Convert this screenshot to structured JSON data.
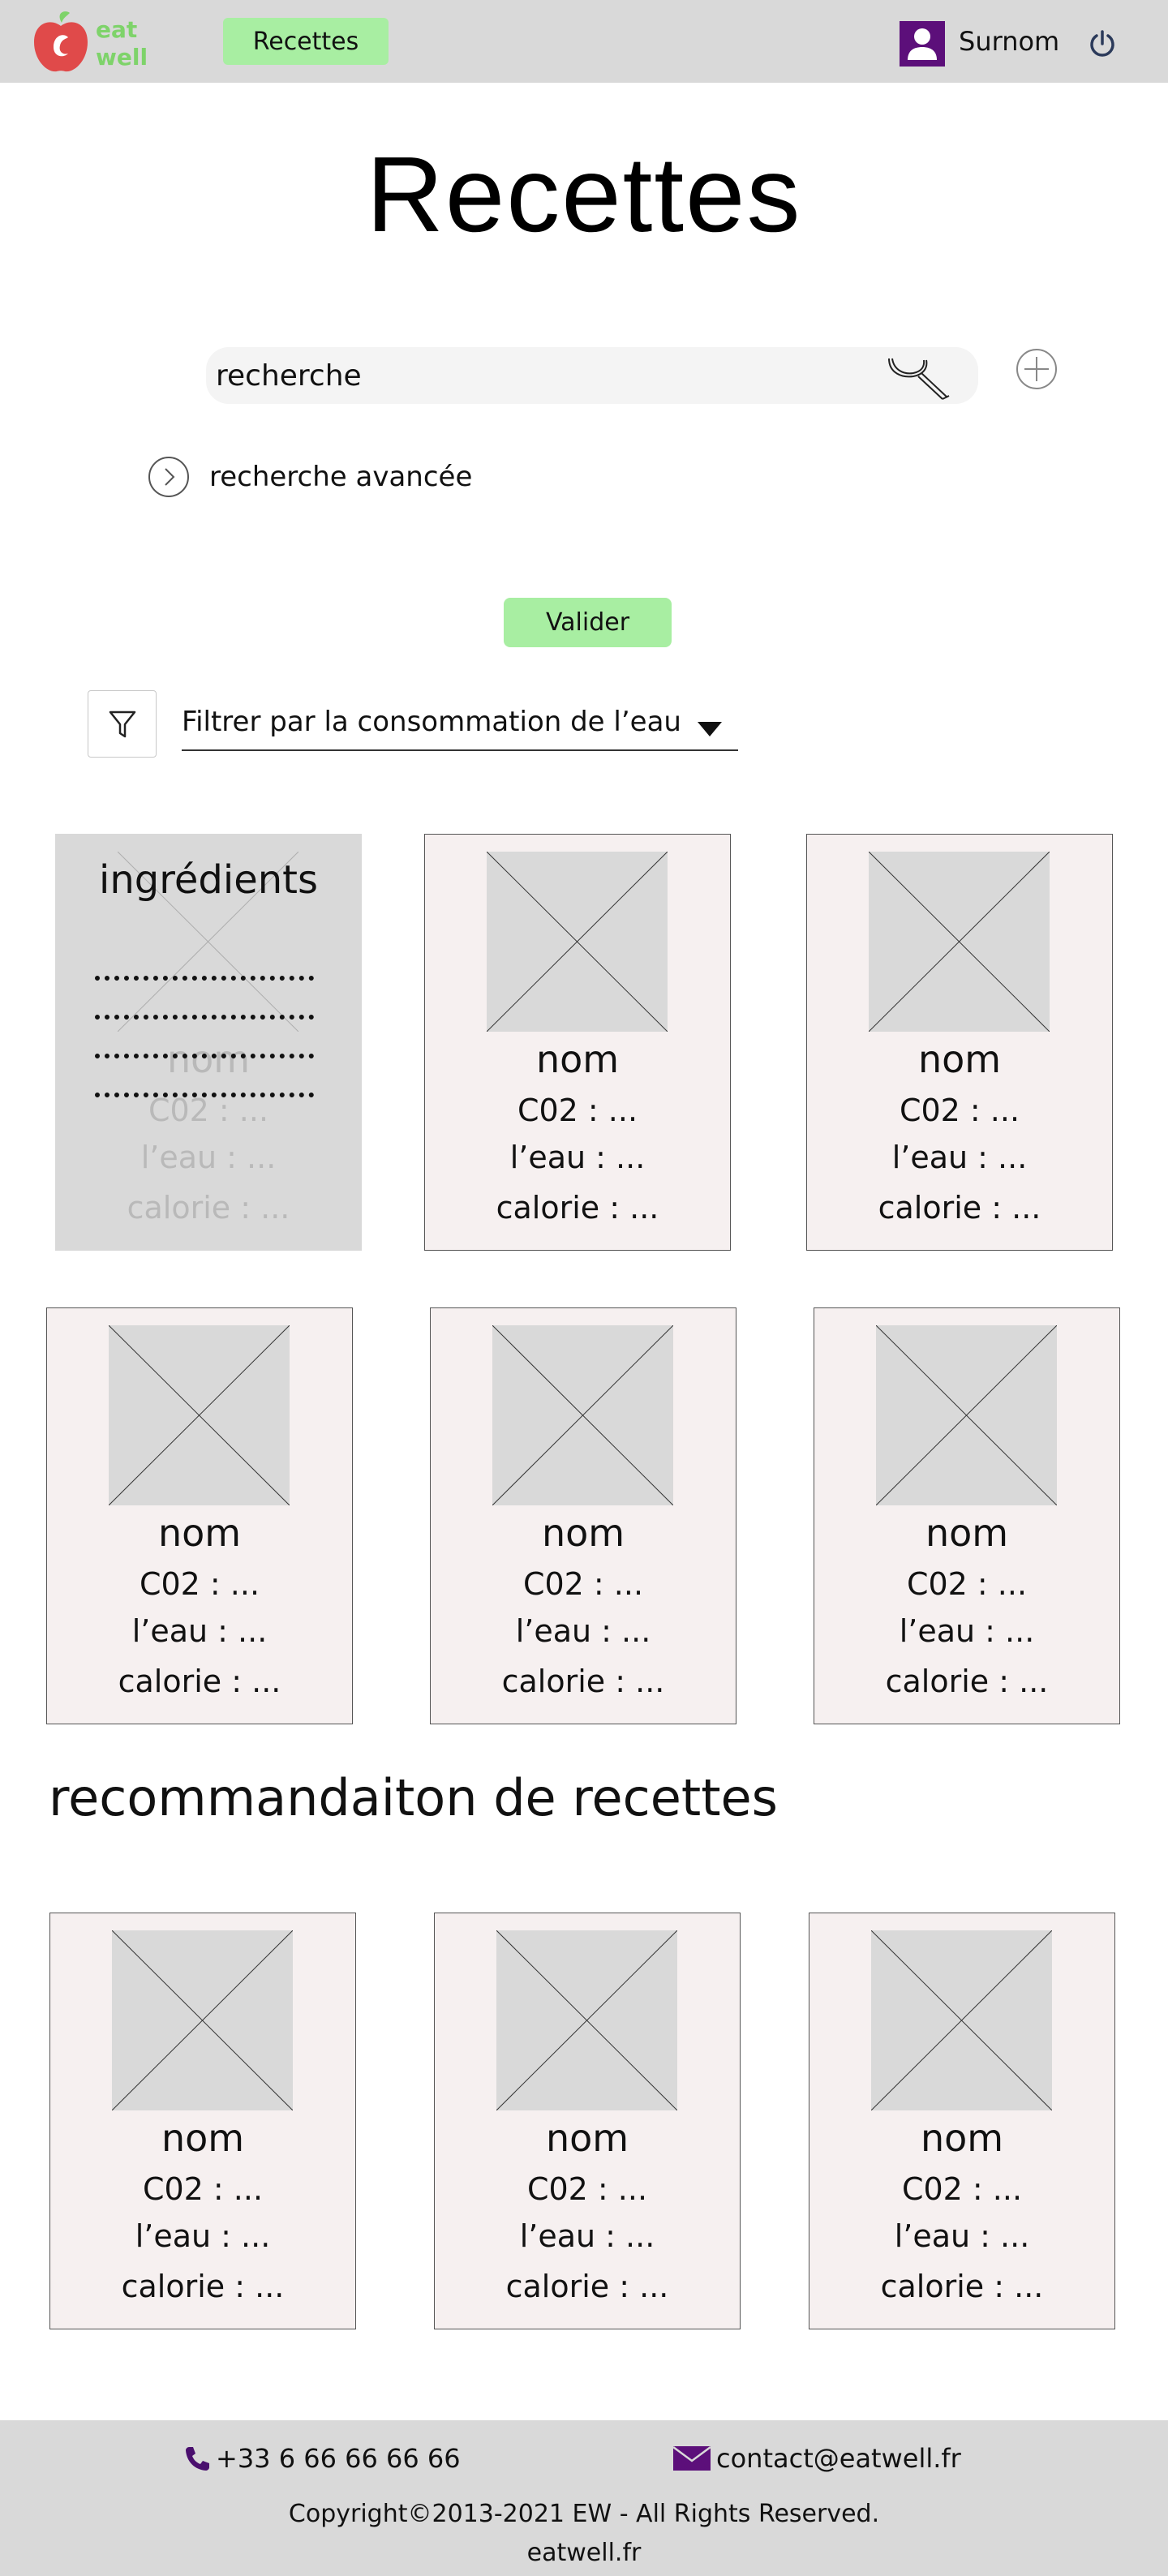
{
  "header": {
    "logo_text_1": "eat",
    "logo_text_2": "well",
    "nav_label": "Recettes",
    "username": "Surnom"
  },
  "page_title": "Recettes",
  "search": {
    "placeholder": "recherche",
    "value": "recherche",
    "advanced_label": "recherche avancée",
    "submit_label": "Valider"
  },
  "filter": {
    "selected": "Filtrer par la consommation de l’eau"
  },
  "hover_card": {
    "title": "ingrédients"
  },
  "recipes": [
    {
      "name": "nom",
      "co2": "C02 : ...",
      "water": "l’eau : ...",
      "calories": "calorie : ..."
    },
    {
      "name": "nom",
      "co2": "C02 : ...",
      "water": "l’eau : ...",
      "calories": "calorie : ..."
    },
    {
      "name": "nom",
      "co2": "C02 : ...",
      "water": "l’eau : ...",
      "calories": "calorie : ..."
    },
    {
      "name": "nom",
      "co2": "C02 : ...",
      "water": "l’eau : ...",
      "calories": "calorie : ..."
    },
    {
      "name": "nom",
      "co2": "C02 : ...",
      "water": "l’eau : ...",
      "calories": "calorie : ..."
    },
    {
      "name": "nom",
      "co2": "C02 : ...",
      "water": "l’eau : ...",
      "calories": "calorie : ..."
    }
  ],
  "recommendations": {
    "title": "recommandaiton de  recettes",
    "items": [
      {
        "name": "nom",
        "co2": "C02 : ...",
        "water": "l’eau : ...",
        "calories": "calorie : ..."
      },
      {
        "name": "nom",
        "co2": "C02 : ...",
        "water": "l’eau : ...",
        "calories": "calorie : ..."
      },
      {
        "name": "nom",
        "co2": "C02 : ...",
        "water": "l’eau : ...",
        "calories": "calorie : ..."
      }
    ]
  },
  "footer": {
    "phone": "+33 6 66 66 66 66",
    "email": "contact@eatwell.fr",
    "copyright": "Copyright©2013-2021 EW - All Rights Reserved.",
    "site": "eatwell.fr"
  },
  "colors": {
    "header_bg": "#d9d9d9",
    "accent_green": "#a8eea2",
    "logo_green": "#7ed36a",
    "logo_red": "#e04a4a",
    "avatar_purple": "#5c0f7a",
    "card_bg": "#f6f0f0"
  },
  "icons": [
    "apple-logo-icon",
    "user-avatar-icon",
    "power-icon",
    "search-icon",
    "add-circle-icon",
    "chevron-right-circle-icon",
    "filter-funnel-icon",
    "dropdown-caret-icon",
    "image-placeholder-icon",
    "phone-icon",
    "mail-icon"
  ]
}
